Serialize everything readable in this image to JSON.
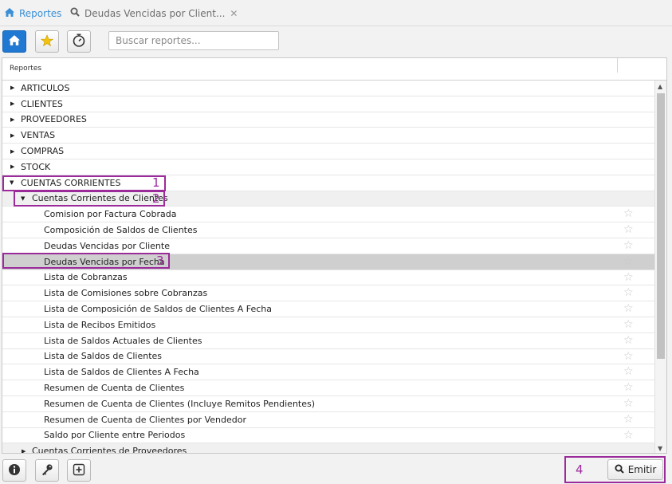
{
  "tabs": [
    {
      "label": "Reportes",
      "icon": "home-icon",
      "active": true
    },
    {
      "label": "Deudas Vencidas por Client...",
      "icon": "search-icon",
      "closable": true
    }
  ],
  "toolbar": {
    "search_placeholder": "Buscar reportes..."
  },
  "panel": {
    "header_title": "Reportes"
  },
  "tree": {
    "categories_top": [
      "ARTICULOS",
      "CLIENTES",
      "PROVEEDORES",
      "VENTAS",
      "COMPRAS",
      "STOCK"
    ],
    "expanded_category": "CUENTAS CORRIENTES",
    "expanded_sub": "Cuentas Corrientes de Clientes",
    "reports": [
      "Comision por Factura Cobrada",
      "Composición de Saldos de Clientes",
      "Deudas Vencidas por Cliente",
      "Deudas Vencidas por Fecha",
      "Lista de Cobranzas",
      "Lista de Comisiones sobre Cobranzas",
      "Lista de Composición de Saldos de Clientes A Fecha",
      "Lista de Recibos Emitidos",
      "Lista de Saldos Actuales de Clientes",
      "Lista de Saldos de Clientes",
      "Lista de Saldos de Clientes A Fecha",
      "Resumen de Cuenta de Clientes",
      "Resumen de Cuenta de Clientes (Incluye Remitos Pendientes)",
      "Resumen de Cuenta de Clientes por Vendedor",
      "Saldo por Cliente entre Periodos"
    ],
    "selected_report": "Deudas Vencidas por Fecha",
    "next_sub": "Cuentas Corrientes de Proveedores"
  },
  "footer": {
    "emit_label": "Emitir"
  },
  "annotations": [
    "1",
    "2",
    "3",
    "4"
  ],
  "colors": {
    "accent": "#1f78d1",
    "annotation": "#9b2a9b",
    "selected_row": "#cfcfcf"
  }
}
